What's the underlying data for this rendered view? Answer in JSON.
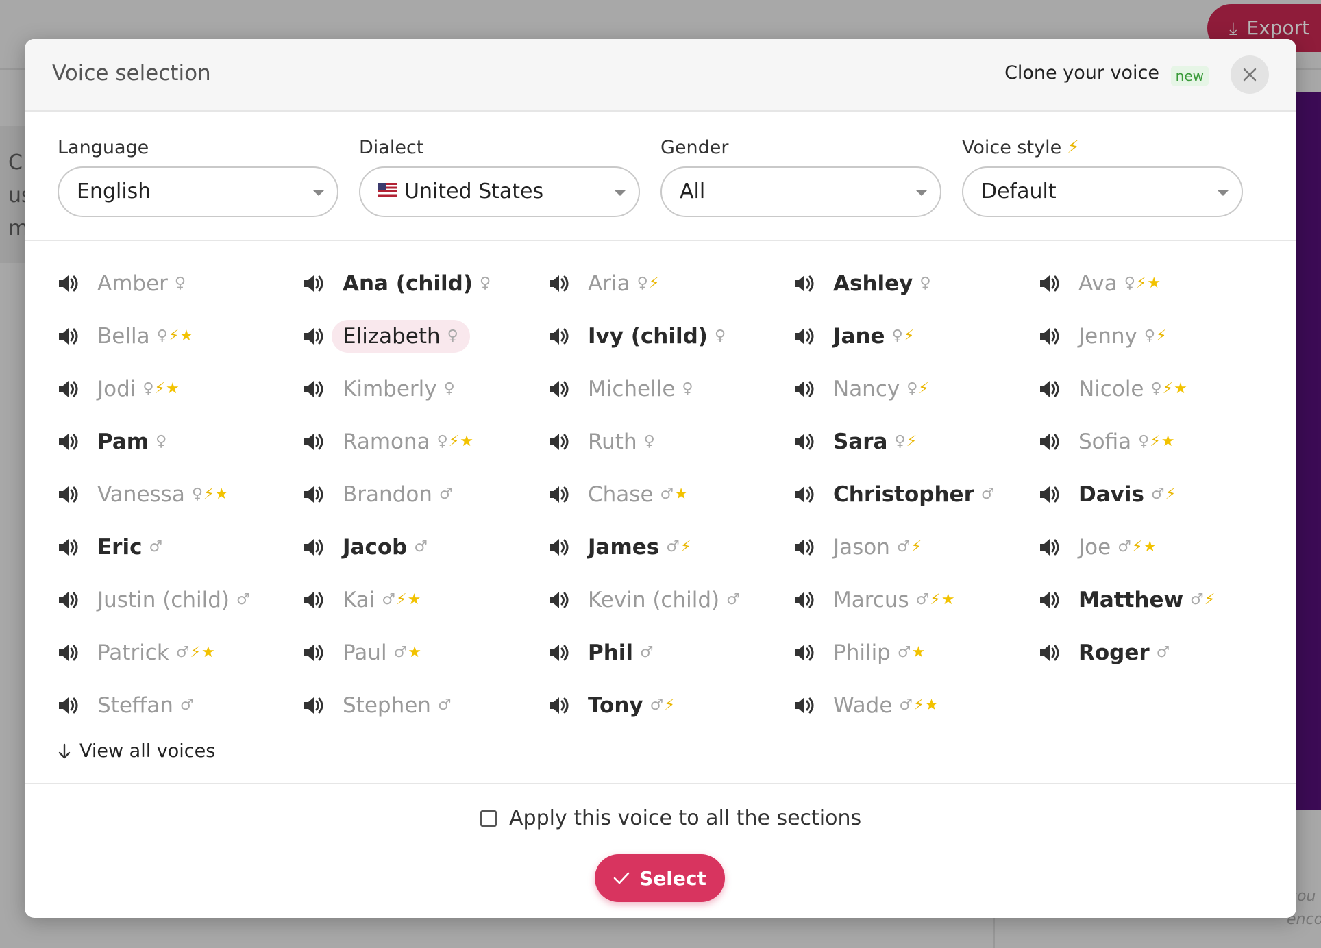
{
  "background": {
    "export_label": "Export",
    "left_letters": [
      "C",
      "us",
      "m"
    ],
    "faint_text": [
      "you",
      "enco"
    ]
  },
  "modal": {
    "title": "Voice selection",
    "clone_label": "Clone your voice",
    "new_badge": "new",
    "close_icon": "close-icon",
    "filters": [
      {
        "label": "Language",
        "value": "English"
      },
      {
        "label": "Dialect",
        "value": "United States",
        "flag": "us-flag-icon"
      },
      {
        "label": "Gender",
        "value": "All"
      },
      {
        "label": "Voice style",
        "value": "Default",
        "label_icon": "bolt-icon"
      }
    ],
    "tag_legend": {
      "female": "♀",
      "male": "♂",
      "style": "⚡",
      "premium": "⭐"
    },
    "voices": [
      {
        "name": "Amber",
        "tags": "♀",
        "state": "muted"
      },
      {
        "name": "Ana (child)",
        "tags": "♀",
        "state": "strong"
      },
      {
        "name": "Aria",
        "tags": "♀⚡",
        "state": "muted"
      },
      {
        "name": "Ashley",
        "tags": "♀",
        "state": "strong"
      },
      {
        "name": "Ava",
        "tags": "♀⚡⭐",
        "state": "muted"
      },
      {
        "name": "Bella",
        "tags": "♀⚡⭐",
        "state": "muted"
      },
      {
        "name": "Elizabeth",
        "tags": "♀",
        "state": "selected"
      },
      {
        "name": "Ivy (child)",
        "tags": "♀",
        "state": "strong"
      },
      {
        "name": "Jane",
        "tags": "♀⚡",
        "state": "strong"
      },
      {
        "name": "Jenny",
        "tags": "♀⚡",
        "state": "muted"
      },
      {
        "name": "Jodi",
        "tags": "♀⚡⭐",
        "state": "muted"
      },
      {
        "name": "Kimberly",
        "tags": "♀",
        "state": "muted"
      },
      {
        "name": "Michelle",
        "tags": "♀",
        "state": "muted"
      },
      {
        "name": "Nancy",
        "tags": "♀⚡",
        "state": "muted"
      },
      {
        "name": "Nicole",
        "tags": "♀⚡⭐",
        "state": "muted"
      },
      {
        "name": "Pam",
        "tags": "♀",
        "state": "strong"
      },
      {
        "name": "Ramona",
        "tags": "♀⚡⭐",
        "state": "muted"
      },
      {
        "name": "Ruth",
        "tags": "♀",
        "state": "muted"
      },
      {
        "name": "Sara",
        "tags": "♀⚡",
        "state": "strong"
      },
      {
        "name": "Sofia",
        "tags": "♀⚡⭐",
        "state": "muted"
      },
      {
        "name": "Vanessa",
        "tags": "♀⚡⭐",
        "state": "muted"
      },
      {
        "name": "Brandon",
        "tags": "♂",
        "state": "muted"
      },
      {
        "name": "Chase",
        "tags": "♂⭐",
        "state": "muted"
      },
      {
        "name": "Christopher",
        "tags": "♂",
        "state": "strong"
      },
      {
        "name": "Davis",
        "tags": "♂⚡",
        "state": "strong"
      },
      {
        "name": "Eric",
        "tags": "♂",
        "state": "strong"
      },
      {
        "name": "Jacob",
        "tags": "♂",
        "state": "strong"
      },
      {
        "name": "James",
        "tags": "♂⚡",
        "state": "strong"
      },
      {
        "name": "Jason",
        "tags": "♂⚡",
        "state": "muted"
      },
      {
        "name": "Joe",
        "tags": "♂⚡⭐",
        "state": "muted"
      },
      {
        "name": "Justin (child)",
        "tags": "♂",
        "state": "muted"
      },
      {
        "name": "Kai",
        "tags": "♂⚡⭐",
        "state": "muted"
      },
      {
        "name": "Kevin (child)",
        "tags": "♂",
        "state": "muted"
      },
      {
        "name": "Marcus",
        "tags": "♂⚡⭐",
        "state": "muted"
      },
      {
        "name": "Matthew",
        "tags": "♂⚡",
        "state": "strong"
      },
      {
        "name": "Patrick",
        "tags": "♂⚡⭐",
        "state": "muted"
      },
      {
        "name": "Paul",
        "tags": "♂⭐",
        "state": "muted"
      },
      {
        "name": "Phil",
        "tags": "♂",
        "state": "strong"
      },
      {
        "name": "Philip",
        "tags": "♂⭐",
        "state": "muted"
      },
      {
        "name": "Roger",
        "tags": "♂",
        "state": "strong"
      },
      {
        "name": "Steffan",
        "tags": "♂",
        "state": "muted"
      },
      {
        "name": "Stephen",
        "tags": "♂",
        "state": "muted"
      },
      {
        "name": "Tony",
        "tags": "♂⚡",
        "state": "strong"
      },
      {
        "name": "Wade",
        "tags": "♂⚡⭐",
        "state": "muted"
      }
    ],
    "view_all_label": "View all voices",
    "apply_all_label": "Apply this voice to all the sections",
    "apply_all_checked": false,
    "select_label": "Select"
  },
  "colors": {
    "accent": "#d8345f",
    "selected_bg": "#f9e8ed",
    "badge_bg": "#e6f5e6",
    "badge_text": "#3a9a3a"
  }
}
